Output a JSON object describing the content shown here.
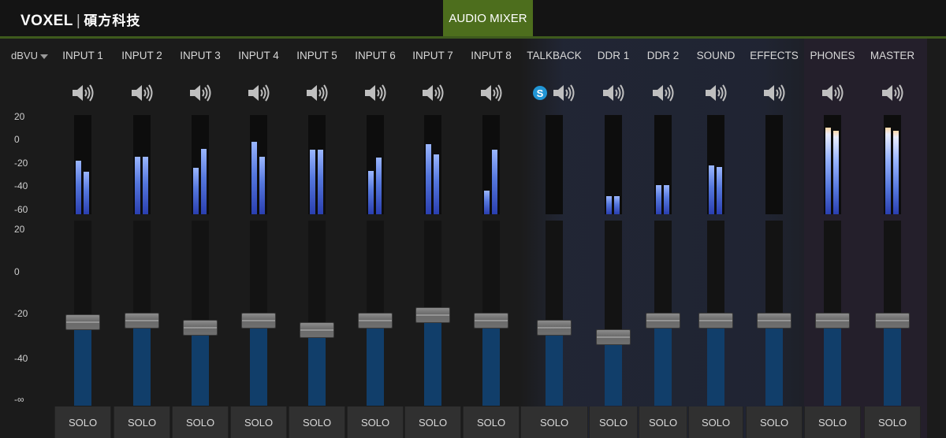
{
  "brand": {
    "logo": "VOXEL",
    "separator": "|",
    "company": "碩方科技"
  },
  "tab": {
    "label": "AUDIO MIXER"
  },
  "scale": {
    "label": "dBVU",
    "meter_ticks": [
      "20",
      "0",
      "-20",
      "-40",
      "-60"
    ],
    "fader_ticks": [
      "20",
      "0",
      "-20",
      "-40",
      "-∞"
    ]
  },
  "solo_label": "SOLO",
  "icons": {
    "speaker": "speaker-icon",
    "skype": "skype-icon",
    "dropdown": "chevron-down-icon"
  },
  "colors": {
    "tab_bg": "#4d6e1d",
    "fader_fill": "#113e6a",
    "meter": "#5577dd"
  },
  "channels": [
    {
      "name": "INPUT 1",
      "meter_l": 0.54,
      "meter_r": 0.43,
      "fader": 0.45
    },
    {
      "name": "INPUT 2",
      "meter_l": 0.58,
      "meter_r": 0.58,
      "fader": 0.46
    },
    {
      "name": "INPUT 3",
      "meter_l": 0.47,
      "meter_r": 0.66,
      "fader": 0.42
    },
    {
      "name": "INPUT 4",
      "meter_l": 0.73,
      "meter_r": 0.58,
      "fader": 0.46
    },
    {
      "name": "INPUT 5",
      "meter_l": 0.65,
      "meter_r": 0.65,
      "fader": 0.41
    },
    {
      "name": "INPUT 6",
      "meter_l": 0.44,
      "meter_r": 0.57,
      "fader": 0.46
    },
    {
      "name": "INPUT 7",
      "meter_l": 0.71,
      "meter_r": 0.6,
      "fader": 0.49
    },
    {
      "name": "INPUT 8",
      "meter_l": 0.24,
      "meter_r": 0.65,
      "fader": 0.46
    },
    {
      "name": "TALKBACK",
      "meter_l": 0.0,
      "meter_r": 0.0,
      "fader": 0.42,
      "skype": true
    },
    {
      "name": "DDR 1",
      "meter_l": 0.18,
      "meter_r": 0.18,
      "fader": 0.37
    },
    {
      "name": "DDR 2",
      "meter_l": 0.29,
      "meter_r": 0.29,
      "fader": 0.46
    },
    {
      "name": "SOUND",
      "meter_l": 0.49,
      "meter_r": 0.48,
      "fader": 0.46
    },
    {
      "name": "EFFECTS",
      "meter_l": 0.0,
      "meter_r": 0.0,
      "fader": 0.46
    },
    {
      "name": "PHONES",
      "meter_l": 0.87,
      "meter_r": 0.84,
      "fader": 0.46
    },
    {
      "name": "MASTER",
      "meter_l": 0.87,
      "meter_r": 0.84,
      "fader": 0.46
    }
  ]
}
